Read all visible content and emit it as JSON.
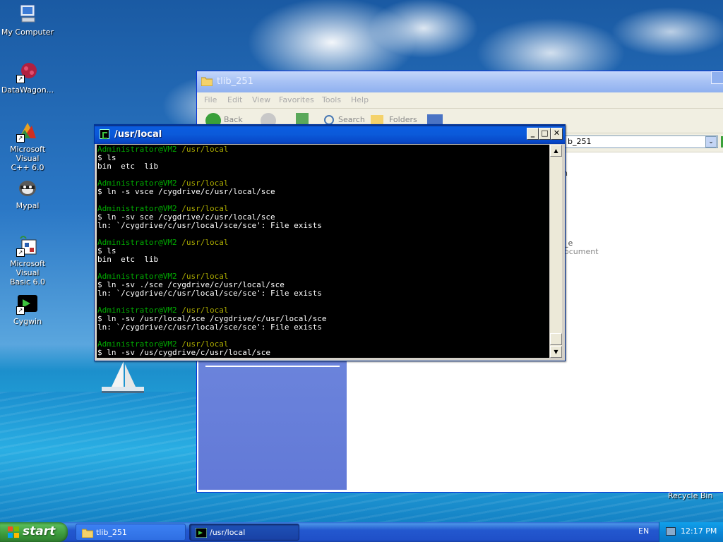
{
  "desktop": {
    "icons": [
      {
        "label": "My Computer",
        "icon": "my-computer-icon"
      },
      {
        "label": "DataWagon...",
        "icon": "datawagon-icon"
      },
      {
        "label_line1": "Microsoft Visual",
        "label_line2": "C++ 6.0",
        "icon": "visual-cpp-icon"
      },
      {
        "label": "Mypal",
        "icon": "mypal-icon"
      },
      {
        "label_line1": "Microsoft Visual",
        "label_line2": "Basic 6.0",
        "icon": "visual-basic-icon"
      },
      {
        "label": "Cygwin",
        "icon": "cygwin-icon"
      }
    ],
    "recycle_bin_label": "Recycle Bin"
  },
  "explorer": {
    "title": "tlib_251",
    "menu": [
      "File",
      "Edit",
      "View",
      "Favorites",
      "Tools",
      "Help"
    ],
    "toolbar": {
      "back": "Back",
      "search": "Search",
      "folders": "Folders"
    },
    "address_value": "b_251",
    "right_items": {
      "item1": "n",
      "item2": "_e",
      "item3": "ocument"
    }
  },
  "terminal": {
    "title": "/usr/local",
    "prompt_user": "Administrator@VM2",
    "prompt_path": "/usr/local",
    "lines": [
      {
        "type": "prompt"
      },
      {
        "type": "cmd",
        "text": "$ ls"
      },
      {
        "type": "out",
        "text": "bin  etc  lib"
      },
      {
        "type": "blank"
      },
      {
        "type": "prompt"
      },
      {
        "type": "cmd",
        "text": "$ ln -s vsce /cygdrive/c/usr/local/sce"
      },
      {
        "type": "blank"
      },
      {
        "type": "prompt"
      },
      {
        "type": "cmd",
        "text": "$ ln -sv sce /cygdrive/c/usr/local/sce"
      },
      {
        "type": "out",
        "text": "ln: `/cygdrive/c/usr/local/sce/sce': File exists"
      },
      {
        "type": "blank"
      },
      {
        "type": "prompt"
      },
      {
        "type": "cmd",
        "text": "$ ls"
      },
      {
        "type": "out",
        "text": "bin  etc  lib"
      },
      {
        "type": "blank"
      },
      {
        "type": "prompt"
      },
      {
        "type": "cmd",
        "text": "$ ln -sv ./sce /cygdrive/c/usr/local/sce"
      },
      {
        "type": "out",
        "text": "ln: `/cygdrive/c/usr/local/sce/sce': File exists"
      },
      {
        "type": "blank"
      },
      {
        "type": "prompt"
      },
      {
        "type": "cmd",
        "text": "$ ln -sv /usr/local/sce /cygdrive/c/usr/local/sce"
      },
      {
        "type": "out",
        "text": "ln: `/cygdrive/c/usr/local/sce/sce': File exists"
      },
      {
        "type": "blank"
      },
      {
        "type": "prompt"
      },
      {
        "type": "cmd",
        "text": "$ ln -sv /us/cygdrive/c/usr/local/sce"
      }
    ]
  },
  "taskbar": {
    "start_label": "start",
    "tasks": [
      {
        "label": "tlib_251",
        "icon": "folder-icon"
      },
      {
        "label": "/usr/local",
        "icon": "cygwin-terminal-icon"
      }
    ],
    "language": "EN",
    "clock": "12:17 PM"
  },
  "colors": {
    "prompt_green": "#00aa00",
    "prompt_path_yellow": "#aaaa00",
    "xp_title_blue": "#0b5ad9",
    "start_green": "#3c9a3c"
  }
}
